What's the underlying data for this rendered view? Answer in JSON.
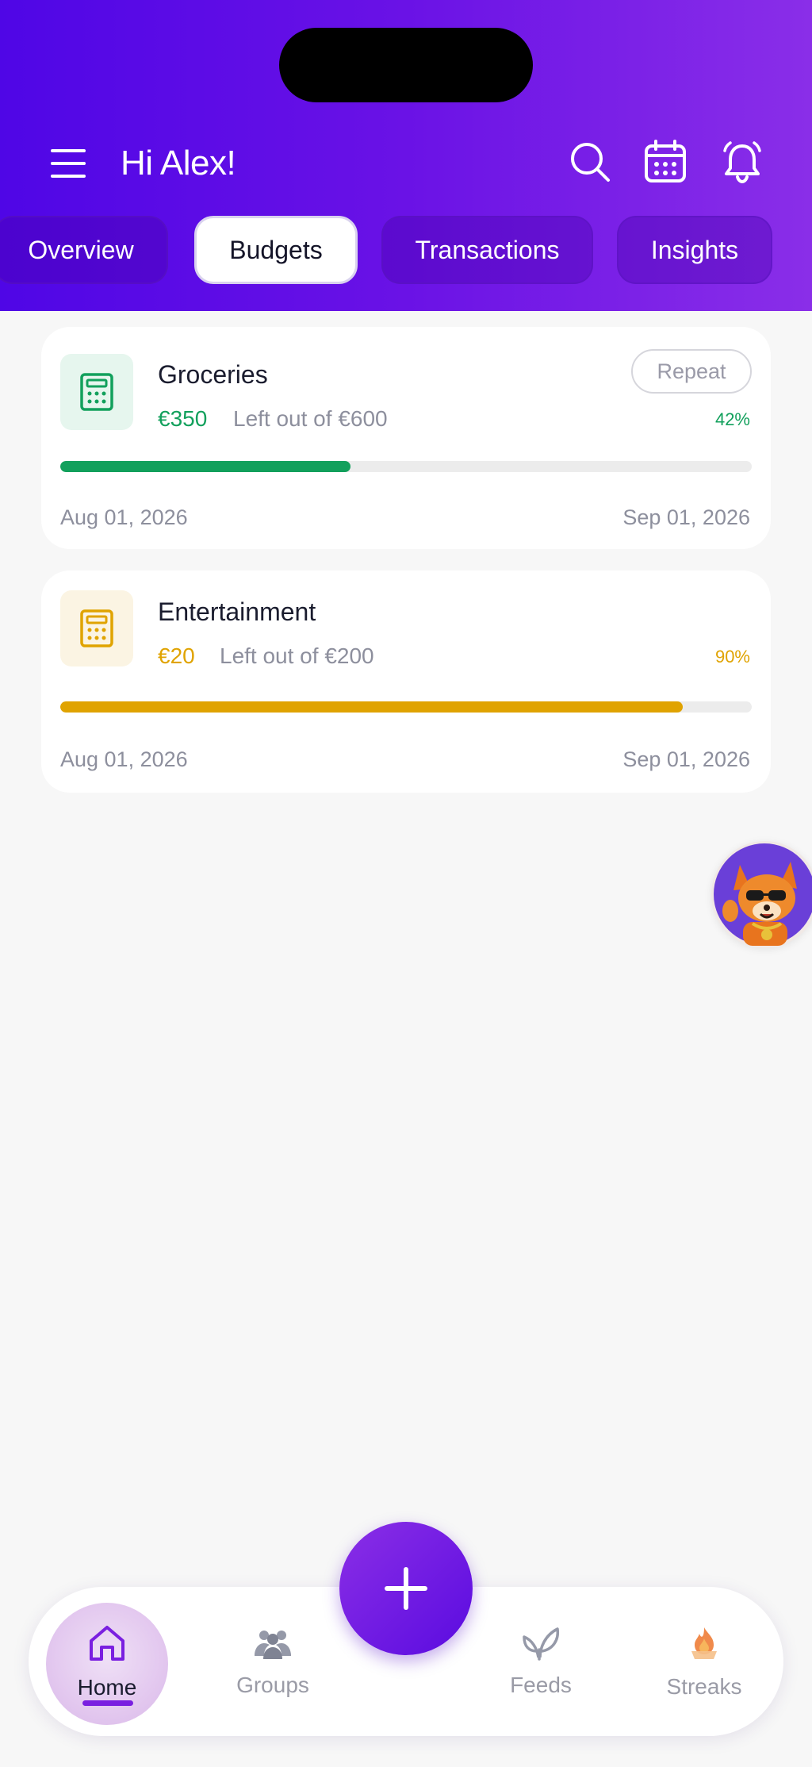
{
  "header": {
    "greeting": "Hi Alex!",
    "icons": [
      "menu-icon",
      "search-icon",
      "calendar-icon",
      "bell-icon"
    ]
  },
  "tabs": [
    {
      "label": "Overview",
      "active": false
    },
    {
      "label": "Budgets",
      "active": true
    },
    {
      "label": "Transactions",
      "active": false
    },
    {
      "label": "Insights",
      "active": false
    }
  ],
  "budgets": [
    {
      "name": "Groceries",
      "amount_left": "€350",
      "left_text": "Left out of €600",
      "percent": "42%",
      "progress": 0.42,
      "start_date": "Aug 01, 2026",
      "end_date": "Sep 01, 2026",
      "repeat_label": "Repeat",
      "color": "#12a05c",
      "icon_bg": "#e6f6ee",
      "icon": "calculator-icon"
    },
    {
      "name": "Entertainment",
      "amount_left": "€20",
      "left_text": "Left out of €200",
      "percent": "90%",
      "progress": 0.9,
      "start_date": "Aug 01, 2026",
      "end_date": "Sep 01, 2026",
      "color": "#e0a300",
      "icon_bg": "#fbf4e3",
      "icon": "calculator-icon"
    }
  ],
  "bottom_nav": [
    {
      "label": "Home",
      "icon": "home-icon",
      "active": true
    },
    {
      "label": "Groups",
      "icon": "groups-icon",
      "active": false
    },
    {
      "label": "Feeds",
      "icon": "leaf-icon",
      "active": false
    },
    {
      "label": "Streaks",
      "icon": "flame-icon",
      "active": false
    }
  ],
  "colors": {
    "header_gradient_start": "#4f06e6",
    "header_gradient_end": "#8a2ee8",
    "accent": "#7a1fe0",
    "background": "#f7f7f7"
  }
}
